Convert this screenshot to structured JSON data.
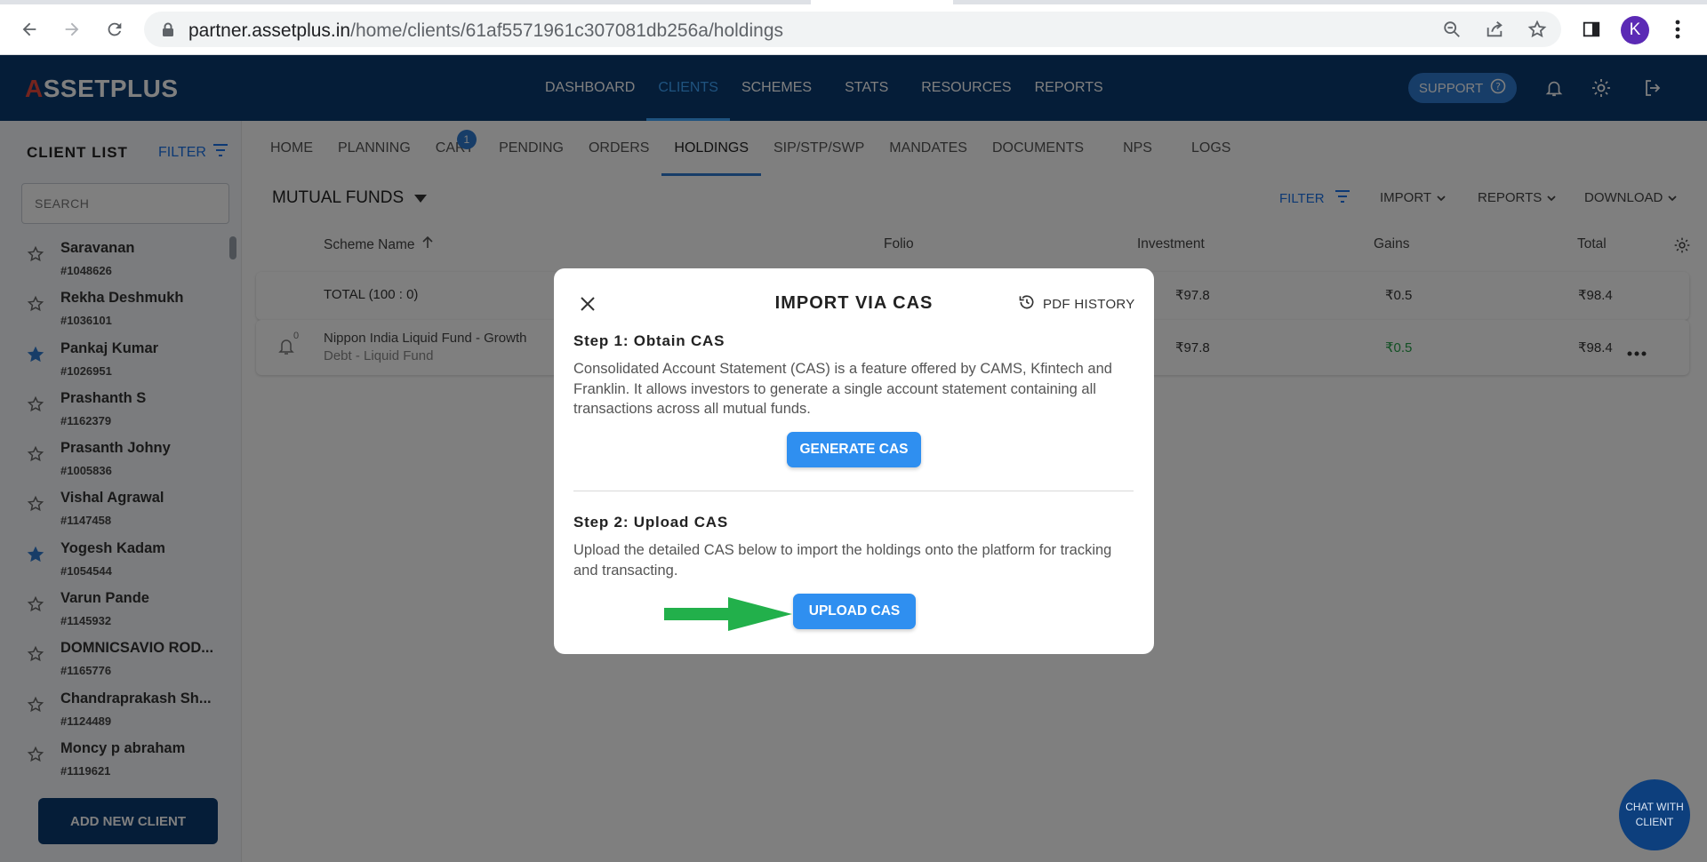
{
  "browser": {
    "url_host": "partner.assetplus.in",
    "url_path": "/home/clients/61af5571961c307081db256a/holdings",
    "avatar_letter": "K"
  },
  "header": {
    "logo": "SSETPLUS",
    "logo_letter": "A",
    "nav": [
      "DASHBOARD",
      "CLIENTS",
      "SCHEMES",
      "STATS",
      "RESOURCES",
      "REPORTS"
    ],
    "active_nav": "CLIENTS",
    "support_label": "SUPPORT"
  },
  "sidebar": {
    "title": "CLIENT LIST",
    "filter_label": "FILTER",
    "search_placeholder": "SEARCH",
    "clients": [
      {
        "name": "Saravanan",
        "id": "#1048626",
        "starred": false
      },
      {
        "name": "Rekha Deshmukh",
        "id": "#1036101",
        "starred": false
      },
      {
        "name": "Pankaj Kumar",
        "id": "#1026951",
        "starred": true
      },
      {
        "name": "Prashanth S",
        "id": "#1162379",
        "starred": false
      },
      {
        "name": "Prasanth Johny",
        "id": "#1005836",
        "starred": false
      },
      {
        "name": "Vishal Agrawal",
        "id": "#1147458",
        "starred": false
      },
      {
        "name": "Yogesh Kadam",
        "id": "#1054544",
        "starred": true
      },
      {
        "name": "Varun Pande",
        "id": "#1145932",
        "starred": false
      },
      {
        "name": "DOMNICSAVIO ROD...",
        "id": "#1165776",
        "starred": false
      },
      {
        "name": "Chandraprakash Sh...",
        "id": "#1124489",
        "starred": false
      },
      {
        "name": "Moncy p abraham",
        "id": "#1119621",
        "starred": false
      }
    ],
    "add_client_label": "ADD NEW CLIENT"
  },
  "subnav": {
    "tabs": [
      "HOME",
      "PLANNING",
      "CART",
      "PENDING",
      "ORDERS",
      "HOLDINGS",
      "SIP/STP/SWP",
      "MANDATES",
      "DOCUMENTS",
      "NPS",
      "LOGS"
    ],
    "active_tab": "HOLDINGS",
    "cart_count": "1"
  },
  "holdings": {
    "section_title": "MUTUAL FUNDS",
    "toolbar": {
      "filter": "FILTER",
      "import": "IMPORT",
      "reports": "REPORTS",
      "download": "DOWNLOAD"
    },
    "columns": {
      "scheme": "Scheme Name",
      "folio": "Folio",
      "investment": "Investment",
      "gains": "Gains",
      "total": "Total"
    },
    "total_row": {
      "label": "TOTAL (100 : 0)",
      "investment": "₹97.8",
      "gains": "₹0.5",
      "total": "₹98.4"
    },
    "rows": [
      {
        "scheme": "Nippon India Liquid Fund - Growth",
        "category": "Debt - Liquid Fund",
        "bell_count": "0",
        "investment": "₹97.8",
        "gains": "₹0.5",
        "total": "₹98.4"
      }
    ]
  },
  "modal": {
    "title": "IMPORT VIA CAS",
    "pdf_history": "PDF HISTORY",
    "step1_title": "Step 1: Obtain CAS",
    "step1_text": "Consolidated Account Statement (CAS) is a feature offered by CAMS, Kfintech and Franklin. It allows investors to generate a single account statement containing all transactions across all mutual funds.",
    "generate_label": "GENERATE CAS",
    "step2_title": "Step 2: Upload CAS",
    "step2_text": "Upload the detailed CAS below to import the holdings onto the platform for tracking and transacting.",
    "upload_label": "UPLOAD CAS",
    "arrow_color": "#22b04b"
  },
  "chat": {
    "label": "CHAT WITH CLIENT"
  }
}
